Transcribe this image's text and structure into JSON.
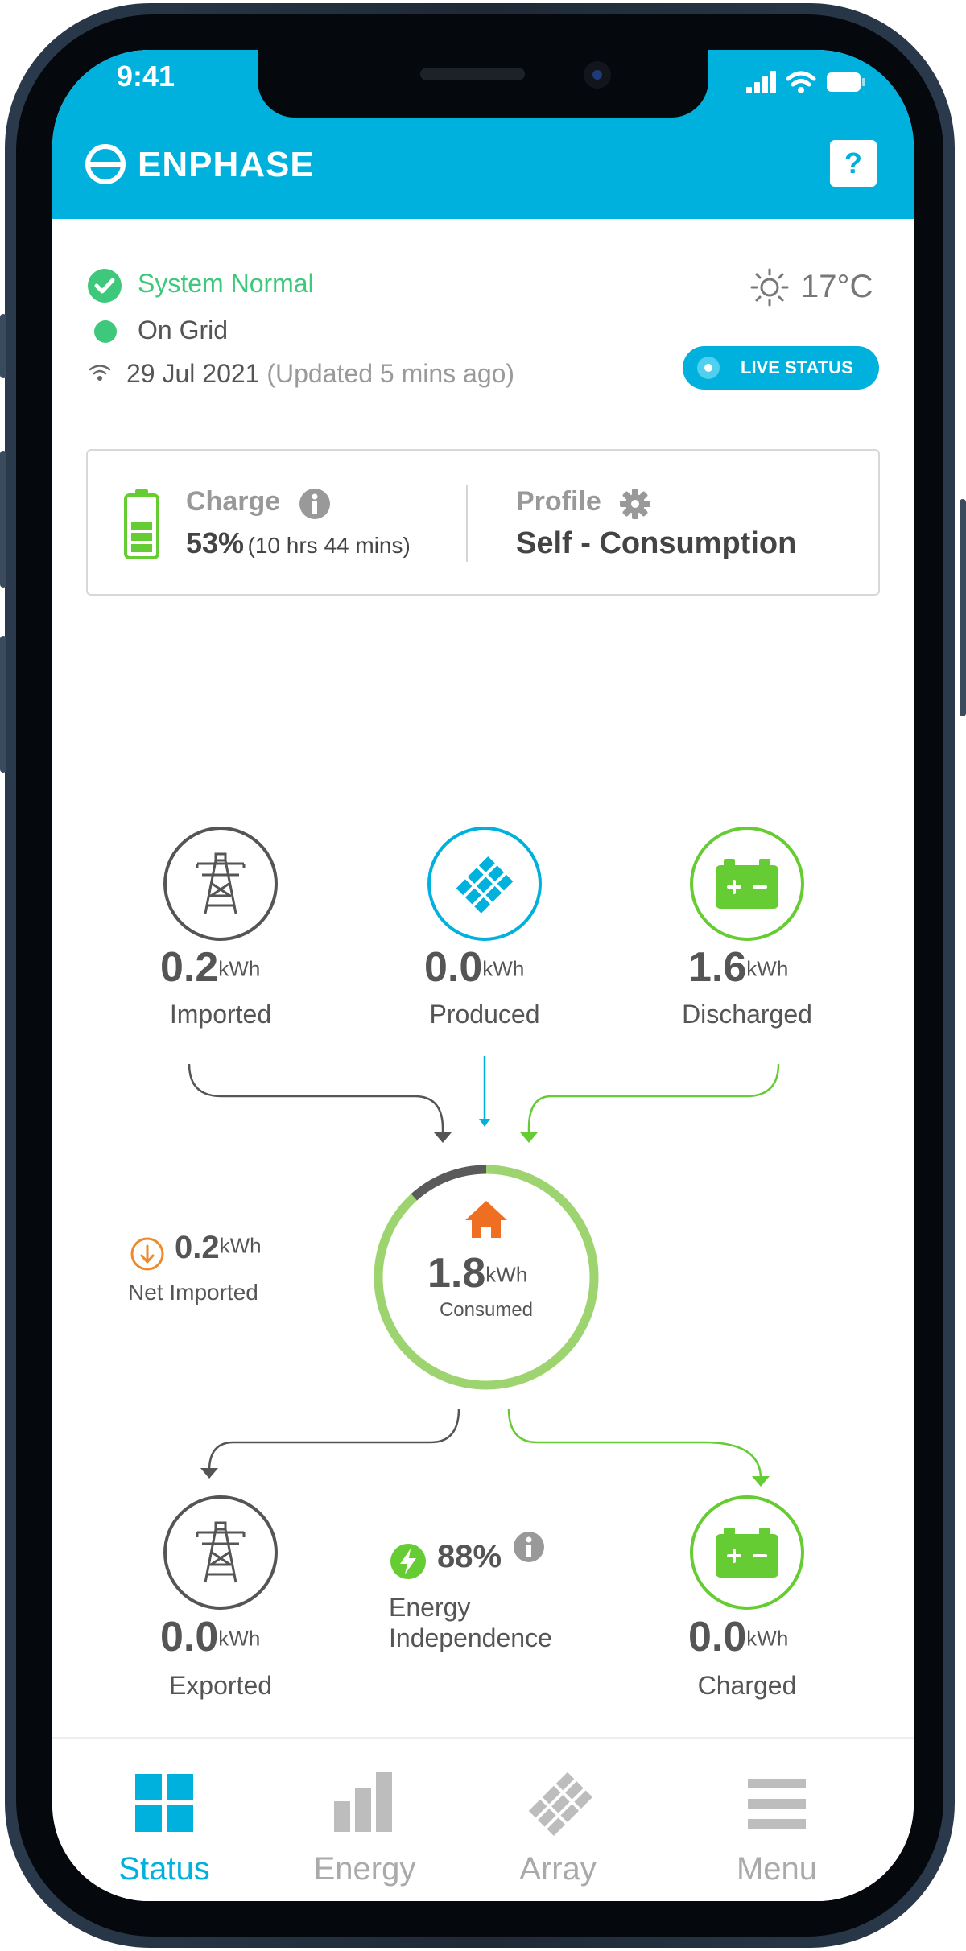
{
  "status_bar": {
    "time": "9:41"
  },
  "header": {
    "brand": "ENPHASE",
    "help_label": "?"
  },
  "system": {
    "status": "System Normal",
    "grid": "On Grid",
    "date": "29 Jul 2021",
    "updated": "(Updated 5 mins ago)",
    "temperature": "17°C",
    "live_status": "LIVE STATUS"
  },
  "battery_card": {
    "charge_label": "Charge",
    "charge_value": "53%",
    "charge_time": "(10 hrs 44 mins)",
    "profile_label": "Profile",
    "profile_value": "Self - Consumption"
  },
  "flow": {
    "imported": {
      "value": "0.2",
      "unit": "kWh",
      "label": "Imported"
    },
    "produced": {
      "value": "0.0",
      "unit": "kWh",
      "label": "Produced"
    },
    "discharged": {
      "value": "1.6",
      "unit": "kWh",
      "label": "Discharged"
    },
    "consumed": {
      "value": "1.8",
      "unit": "kWh",
      "label": "Consumed"
    },
    "net_imported": {
      "value": "0.2",
      "unit": "kWh",
      "label": "Net Imported"
    },
    "exported": {
      "value": "0.0",
      "unit": "kWh",
      "label": "Exported"
    },
    "independence": {
      "value": "88%",
      "label_line1": "Energy",
      "label_line2": "Independence"
    },
    "charged": {
      "value": "0.0",
      "unit": "kWh",
      "label": "Charged"
    }
  },
  "tabs": [
    {
      "label": "Status",
      "active": true
    },
    {
      "label": "Energy",
      "active": false
    },
    {
      "label": "Array",
      "active": false
    },
    {
      "label": "Menu",
      "active": false
    }
  ],
  "colors": {
    "accent": "#00b1dd",
    "green": "#3ec87b",
    "battery_green": "#66cc33",
    "home_orange": "#ef6f22",
    "text_gray": "#555555"
  }
}
